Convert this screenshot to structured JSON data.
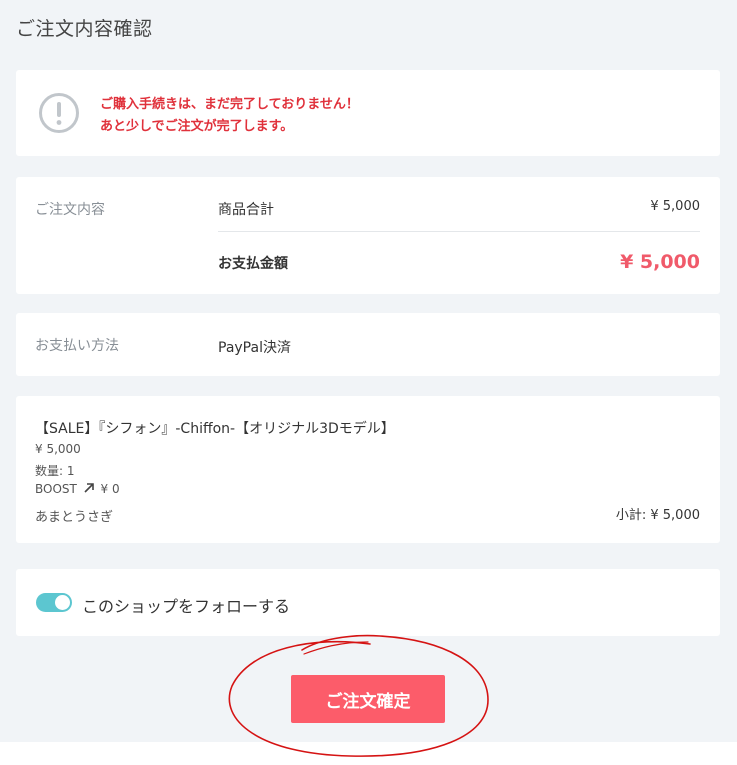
{
  "page": {
    "title": "ご注文内容確認"
  },
  "warning": {
    "line1": "ご購入手続きは、まだ完了しておりません！",
    "line2": "あと少しでご注文が完了します。",
    "color": "#e0313b"
  },
  "order": {
    "section_label": "ご注文内容",
    "subtotal_label": "商品合計",
    "subtotal_value": "¥ 5,000",
    "total_label": "お支払金額",
    "total_value": "¥ 5,000"
  },
  "payment": {
    "section_label": "お支払い方法",
    "method": "PayPal決済"
  },
  "product": {
    "name": "【SALE】『シフォン』-Chiffon-【オリジナル3Dモデル】",
    "price": "¥ 5,000",
    "quantity": "数量: 1",
    "boost_label": "BOOST",
    "boost_value": "¥ 0",
    "shop_name": "あまとうさぎ",
    "line_subtotal": "小計: ¥ 5,000"
  },
  "follow": {
    "label": "このショップをフォローする",
    "enabled": true,
    "toggle_color": "#5cc6d0"
  },
  "confirm": {
    "label": "ご注文確定",
    "color": "#fc5c6a"
  },
  "icons": {
    "warning": "exclamation-circle-icon",
    "boost": "arrow-up-right-icon"
  }
}
